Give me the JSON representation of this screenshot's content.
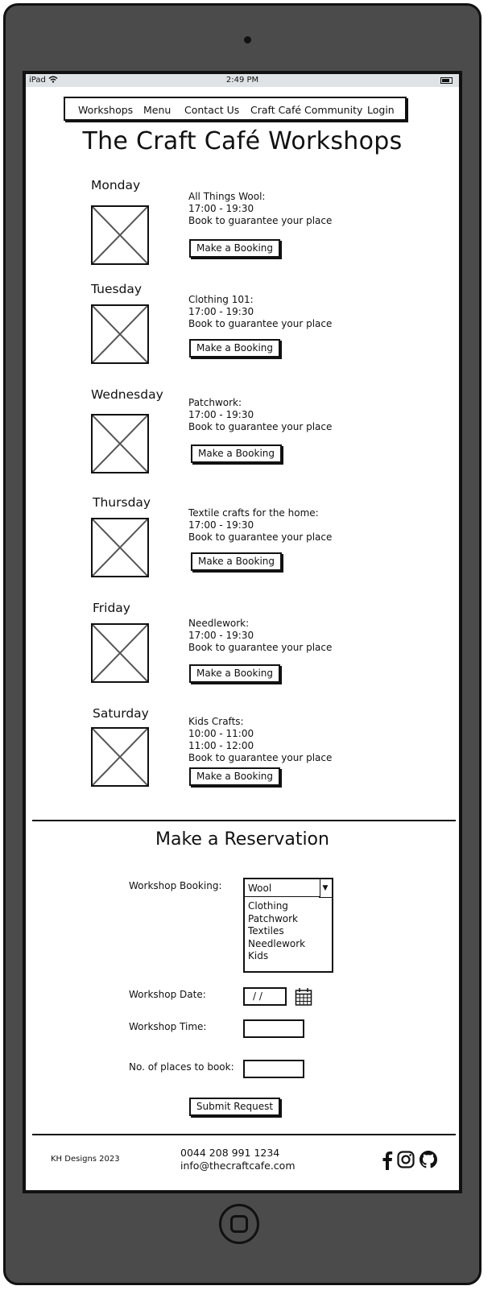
{
  "status": {
    "device": "iPad",
    "time": "2:49 PM"
  },
  "nav": {
    "items": [
      {
        "label": "Workshops"
      },
      {
        "label": "Menu"
      },
      {
        "label": "Contact Us"
      },
      {
        "label": "Craft Café Community"
      },
      {
        "label": "Login"
      }
    ]
  },
  "page_title": "The Craft Café Workshops",
  "workshops": [
    {
      "day": "Monday",
      "lines": [
        "All Things Wool:",
        "17:00 - 19:30",
        "Book to guarantee your place"
      ],
      "button": "Make a Booking"
    },
    {
      "day": "Tuesday",
      "lines": [
        "Clothing 101:",
        "17:00 - 19:30",
        "Book to guarantee your place"
      ],
      "button": "Make a Booking"
    },
    {
      "day": "Wednesday",
      "lines": [
        "Patchwork:",
        "17:00 - 19:30",
        "Book to guarantee your place"
      ],
      "button": "Make a Booking"
    },
    {
      "day": "Thursday",
      "lines": [
        "Textile crafts for the home:",
        "17:00 - 19:30",
        "Book to guarantee your place"
      ],
      "button": "Make a Booking"
    },
    {
      "day": "Friday",
      "lines": [
        "Needlework:",
        "17:00 - 19:30",
        "Book to guarantee your place"
      ],
      "button": "Make a Booking"
    },
    {
      "day": "Saturday",
      "lines": [
        "Kids Crafts:",
        "10:00 - 11:00",
        "11:00 - 12:00",
        "Book to guarantee your place"
      ],
      "button": "Make a Booking"
    }
  ],
  "reservation": {
    "title": "Make a Reservation",
    "booking_label": "Workshop Booking:",
    "booking_selected": "Wool",
    "booking_options": [
      "Clothing",
      "Patchwork",
      "Textiles",
      "Needlework",
      "Kids"
    ],
    "date_label": "Workshop Date:",
    "date_value": "/ /",
    "time_label": "Workshop Time:",
    "places_label": "No. of places to book:",
    "submit": "Submit Request"
  },
  "footer": {
    "brand": "KH Designs 2023",
    "phone": "0044 208 991 1234",
    "email": "info@thecraftcafe.com",
    "icons": [
      "facebook-icon",
      "instagram-icon",
      "github-icon"
    ]
  }
}
